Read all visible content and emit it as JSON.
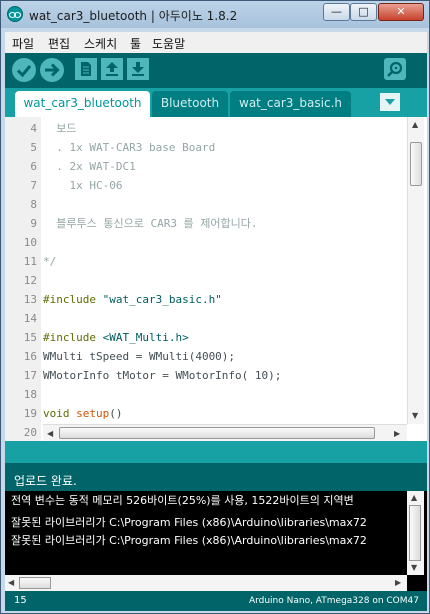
{
  "window": {
    "title": "wat_car3_bluetooth | 아두이노 1.8.2",
    "controls": {
      "minimize": "—",
      "maximize": "□",
      "close": "✕"
    }
  },
  "menu": [
    "파일",
    "편집",
    "스케치",
    "툴",
    "도움말"
  ],
  "toolbar": {
    "icons": [
      "verify-icon",
      "upload-icon",
      "new-icon",
      "open-icon",
      "save-icon",
      "serial-monitor-icon"
    ]
  },
  "tabs": [
    {
      "label": "wat_car3_bluetooth",
      "active": true
    },
    {
      "label": "Bluetooth",
      "active": false
    },
    {
      "label": "wat_car3_basic.h",
      "active": false
    }
  ],
  "editor": {
    "lines": [
      {
        "num": "4",
        "text": "  보드",
        "kind": "comment"
      },
      {
        "num": "5",
        "text": "  . 1x WAT-CAR3 base Board",
        "kind": "comment"
      },
      {
        "num": "6",
        "text": "  . 2x WAT-DC1",
        "kind": "comment"
      },
      {
        "num": "7",
        "text": "    1x HC-06",
        "kind": "comment"
      },
      {
        "num": "8",
        "text": "",
        "kind": "comment"
      },
      {
        "num": "9",
        "text": "  블루투스 통신으로 CAR3 를 제어합니다.",
        "kind": "comment"
      },
      {
        "num": "10",
        "text": "",
        "kind": "comment"
      },
      {
        "num": "11",
        "text": "*/",
        "kind": "comment"
      },
      {
        "num": "12",
        "text": "",
        "kind": "code"
      },
      {
        "num": "13",
        "kw": "#include ",
        "str": "\"wat_car3_basic.h\"",
        "kind": "include"
      },
      {
        "num": "14",
        "text": "",
        "kind": "code"
      },
      {
        "num": "15",
        "kw": "#include ",
        "str": "<WAT_Multi.h>",
        "kind": "include"
      },
      {
        "num": "16",
        "text": "WMulti tSpeed = WMulti(4000);",
        "kind": "code"
      },
      {
        "num": "17",
        "text": "WMotorInfo tMotor = WMotorInfo( 10);",
        "kind": "code"
      },
      {
        "num": "18",
        "text": "",
        "kind": "code"
      },
      {
        "num": "19",
        "kw": "void ",
        "fn": "setup",
        "rest": "()",
        "kind": "func"
      },
      {
        "num": "20",
        "text": "{",
        "kind": "code"
      }
    ]
  },
  "status": {
    "message": "업로드 완료."
  },
  "console": {
    "lines": [
      "전역 변수는 동적 메모리 526바이트(25%)를 사용, 1522바이트의 지역변",
      "잘못된 라이브러리가 C:\\Program Files (x86)\\Arduino\\libraries\\max72",
      "잘못된 라이브러리가 C:\\Program Files (x86)\\Arduino\\libraries\\max72"
    ]
  },
  "footer": {
    "line_number": "15",
    "board": "Arduino Nano, ATmega328 on COM47"
  },
  "colors": {
    "teal_dark": "#006468",
    "teal": "#17a1a5",
    "teal_light": "#4db7bb",
    "comment": "#95a5a6"
  }
}
